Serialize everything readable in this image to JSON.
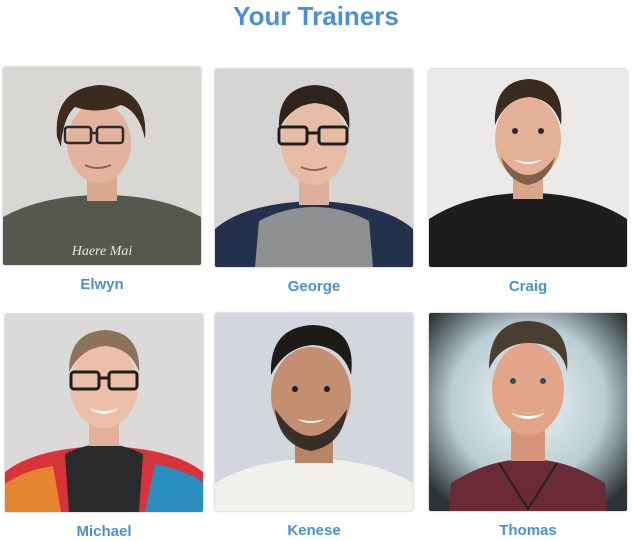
{
  "title": "Your Trainers",
  "trainers": [
    {
      "name": "Elwyn",
      "shirt_text": "Haere Mai"
    },
    {
      "name": "George"
    },
    {
      "name": "Craig"
    },
    {
      "name": "Michael"
    },
    {
      "name": "Kenese"
    },
    {
      "name": "Thomas"
    }
  ],
  "colors": {
    "accent": "#4a90d9",
    "photo_background": "#d8d6d3"
  }
}
